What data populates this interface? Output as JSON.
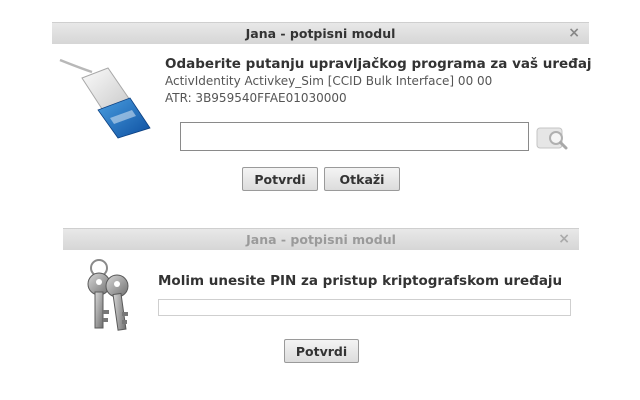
{
  "dialog1": {
    "title": "Jana - potpisni modul",
    "close_symbol": "×",
    "heading": "Odaberite putanju upravljačkog programa za vaš uređaj",
    "device_name": "ActivIdentity Activkey_Sim [CCID Bulk Interface] 00 00",
    "atr": "ATR: 3B959540FFAE01030000",
    "path_value": "",
    "icons": {
      "device": "smartcard-reader-icon",
      "browse": "search-magnifier-icon"
    },
    "confirm_label": "Potvrdi",
    "cancel_label": "Otkaži"
  },
  "dialog2": {
    "title": "Jana - potpisni modul",
    "close_symbol": "×",
    "prompt": "Molim unesite PIN za pristup kriptografskom uređaju",
    "pin_value": "",
    "icons": {
      "keys": "keys-icon"
    },
    "confirm_label": "Potvrdi"
  }
}
